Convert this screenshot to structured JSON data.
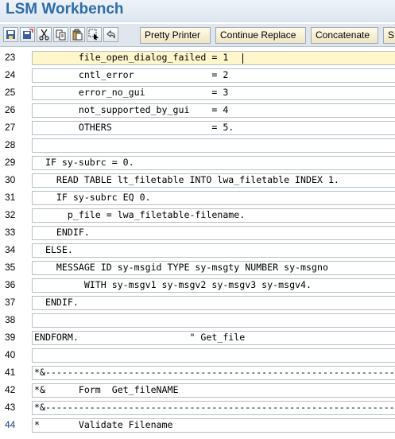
{
  "app": {
    "title": "LSM Workbench"
  },
  "toolbar": {
    "icons": [
      "save-local-icon",
      "save-as-icon",
      "cut-icon",
      "copy-icon",
      "paste-icon",
      "select-icon",
      "undo-icon"
    ],
    "buttons": [
      "Pretty Printer",
      "Continue Replace",
      "Concatenate",
      "S"
    ]
  },
  "editor": {
    "cursor_line": "23",
    "lines": [
      {
        "num": "23",
        "text": "        file_open_dialog_failed = 1"
      },
      {
        "num": "24",
        "text": "        cntl_error              = 2"
      },
      {
        "num": "25",
        "text": "        error_no_gui            = 3"
      },
      {
        "num": "26",
        "text": "        not_supported_by_gui    = 4"
      },
      {
        "num": "27",
        "text": "        OTHERS                  = 5."
      },
      {
        "num": "28",
        "text": ""
      },
      {
        "num": "29",
        "text": "  IF sy-subrc = 0."
      },
      {
        "num": "30",
        "text": "    READ TABLE lt_filetable INTO lwa_filetable INDEX 1."
      },
      {
        "num": "31",
        "text": "    IF sy-subrc EQ 0."
      },
      {
        "num": "32",
        "text": "      p_file = lwa_filetable-filename."
      },
      {
        "num": "33",
        "text": "    ENDIF."
      },
      {
        "num": "34",
        "text": "  ELSE."
      },
      {
        "num": "35",
        "text": "    MESSAGE ID sy-msgid TYPE sy-msgty NUMBER sy-msgno"
      },
      {
        "num": "36",
        "text": "         WITH sy-msgv1 sy-msgv2 sy-msgv3 sy-msgv4."
      },
      {
        "num": "37",
        "text": "  ENDIF."
      },
      {
        "num": "38",
        "text": ""
      },
      {
        "num": "39",
        "text": "ENDFORM.                    \" Get_file"
      },
      {
        "num": "40",
        "text": ""
      },
      {
        "num": "41",
        "text": "*&---------------------------------------------------------------------*"
      },
      {
        "num": "42",
        "text": "*&      Form  Get_fileNAME"
      },
      {
        "num": "43",
        "text": "*&---------------------------------------------------------------------*"
      },
      {
        "num": "44",
        "text": "*       Validate Filename"
      }
    ]
  },
  "colors": {
    "title": "#2f6ca6",
    "toolbar_bg": "#dfe6ee",
    "button_bg": "#f7efd4",
    "cursor_row": "#fff6cc",
    "line_num_highlight": "#1f3c88"
  }
}
